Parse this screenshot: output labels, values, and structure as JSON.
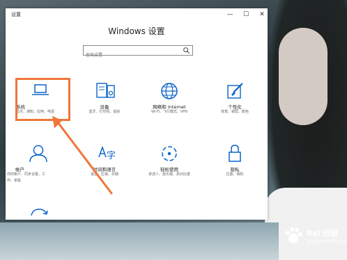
{
  "window": {
    "title": "设置",
    "minimize_glyph": "—",
    "maximize_glyph": "☐",
    "close_glyph": "✕"
  },
  "header": {
    "title": "Windows 设置"
  },
  "search": {
    "placeholder": "查找设置",
    "icon": "search-icon"
  },
  "tiles": [
    {
      "name": "系统",
      "desc": "显示、通知、应用、电源",
      "icon": "laptop-icon"
    },
    {
      "name": "设备",
      "desc": "蓝牙、打印机、鼠标",
      "icon": "devices-icon"
    },
    {
      "name": "网络和 Internet",
      "desc": "Wi-Fi、飞行模式、VPN",
      "icon": "globe-icon"
    },
    {
      "name": "个性化",
      "desc": "背景、锁屏、颜色",
      "icon": "paintbrush-icon"
    },
    {
      "name": "帐户",
      "desc": "你的帐户、同步设置、工作、家庭",
      "icon": "person-icon"
    },
    {
      "name": "时间和语言",
      "desc": "语音、区域、日期",
      "icon": "time-language-icon"
    },
    {
      "name": "轻松使用",
      "desc": "讲述人、放大镜、高对比度",
      "icon": "ease-of-access-icon"
    },
    {
      "name": "隐私",
      "desc": "位置、相机",
      "icon": "lock-icon"
    },
    {
      "name": "",
      "desc": "",
      "icon": "update-icon"
    }
  ],
  "annotation": {
    "highlight_color": "#f0753a",
    "arrow_color": "#f0753a"
  },
  "watermark": {
    "text": "Bai 经验",
    "url": "jingyan.baidu.com"
  },
  "colors": {
    "accent": "#0a64c8",
    "window_bg": "#ffffff"
  }
}
